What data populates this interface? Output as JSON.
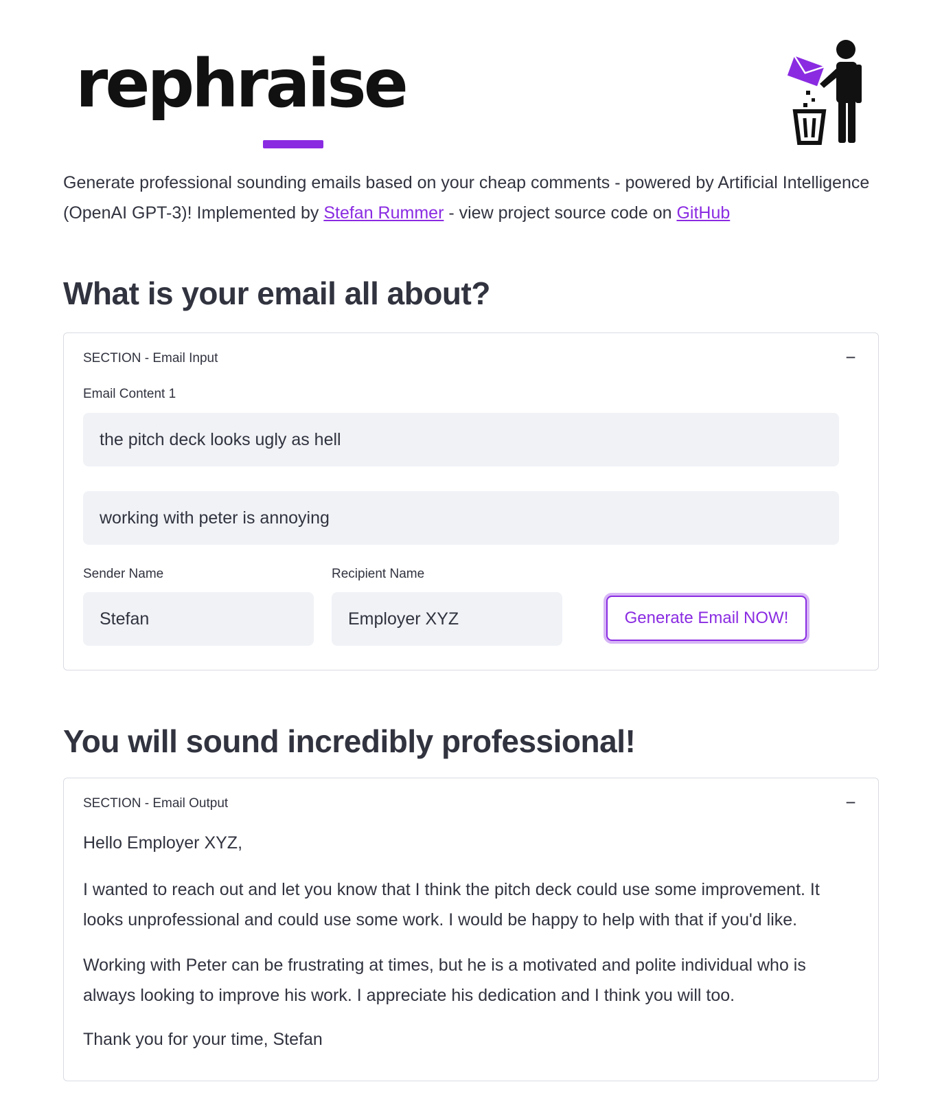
{
  "header": {
    "logo_text": "rephraise",
    "logo_accent_color": "#8a2be2",
    "figure_icon": "person-throwing-email-in-trash-icon"
  },
  "intro": {
    "text_1": "Generate professional sounding emails based on your cheap comments - powered by Artificial Intelligence (OpenAI GPT-3)! Implemented by ",
    "author_link": "Stefan Rummer",
    "text_2": " - view project source code on ",
    "github_link": "GitHub"
  },
  "input_section": {
    "heading": "What is your email all about?",
    "expander_title": "SECTION - Email Input",
    "toggle": "−",
    "content_label": "Email Content 1",
    "content_1_value": "the pitch deck looks ugly as hell",
    "content_2_value": "working with peter is annoying",
    "sender_label": "Sender Name",
    "sender_value": "Stefan",
    "recipient_label": "Recipient Name",
    "recipient_value": "Employer XYZ",
    "generate_button": "Generate Email NOW!"
  },
  "output_section": {
    "heading": "You will sound incredibly professional!",
    "expander_title": "SECTION - Email Output",
    "toggle": "−",
    "greeting": "Hello Employer XYZ,",
    "paragraph_1": "I wanted to reach out and let you know that I think the pitch deck could use some improvement. It looks unprofessional and could use some work. I would be happy to help with that if you'd like.",
    "paragraph_2": "Working with Peter can be frustrating at times, but he is a motivated and polite individual who is always looking to improve his work. I appreciate his dedication and I think you will too.",
    "closing": "Thank you for your time, Stefan"
  }
}
